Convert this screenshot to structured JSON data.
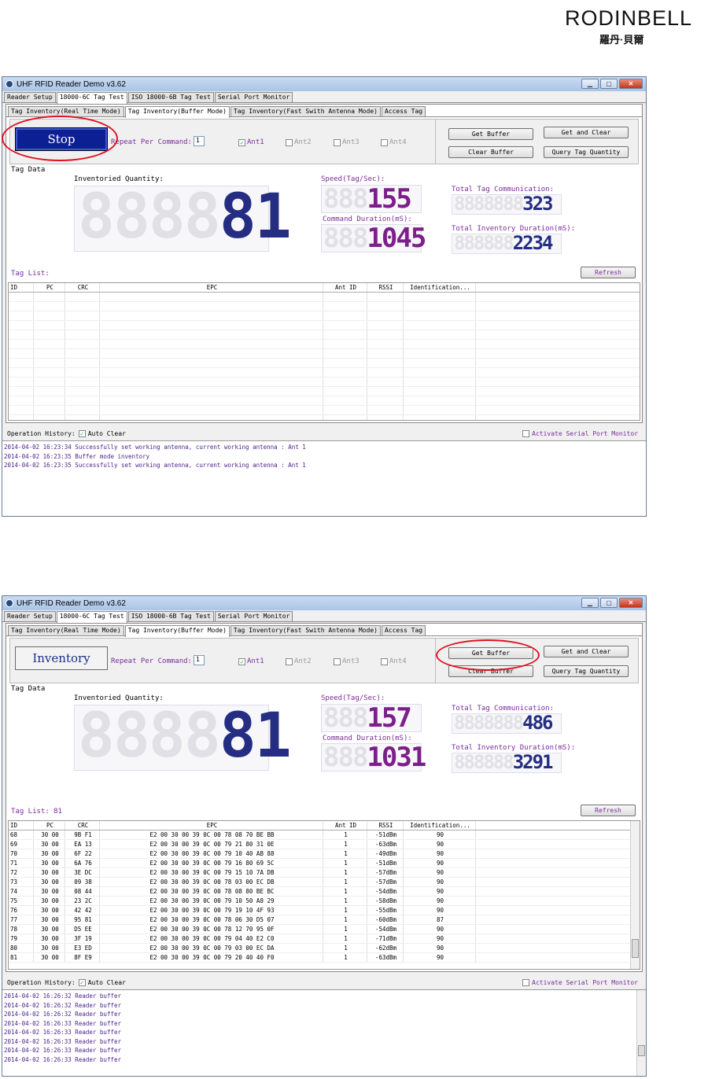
{
  "logo": {
    "brand": "RODINBELL",
    "chinese": "羅丹·貝爾"
  },
  "app": {
    "title": "UHF RFID Reader Demo v3.62"
  },
  "main_tabs": [
    "Reader Setup",
    "18000-6C Tag Test",
    "ISO 18000-6B Tag Test",
    "Serial Port Monitor"
  ],
  "sub_tabs": [
    "Tag Inventory(Real Time Mode)",
    "Tag Inventory(Buffer Mode)",
    "Tag Inventory(Fast Swith Antenna Mode)",
    "Access Tag"
  ],
  "labels": {
    "repeat_per_command": "Repeat Per Command:",
    "tag_data": "Tag Data",
    "inventoried_quantity": "Inventoried Quantity:",
    "speed": "Speed(Tag/Sec):",
    "command_duration": "Command Duration(mS):",
    "total_tag_comm": "Total Tag Communication:",
    "total_inv_duration": "Total Inventory Duration(mS):",
    "refresh": "Refresh",
    "operation_history": "Operation History:",
    "auto_clear": "Auto Clear",
    "activate_serial": "Activate Serial Port Monitor",
    "get_buffer": "Get Buffer",
    "get_and_clear": "Get and Clear",
    "clear_buffer": "Clear Buffer",
    "query_tag_quantity": "Query Tag Quantity"
  },
  "antennas": [
    "Ant1",
    "Ant2",
    "Ant3",
    "Ant4"
  ],
  "columns": [
    "ID",
    "PC",
    "CRC",
    "EPC",
    "Ant ID",
    "RSSI",
    "Identification..."
  ],
  "screen1": {
    "button": "Stop",
    "repeat": "1",
    "inventoried_ghost": "8888",
    "inventoried_value": "81",
    "speed_ghost": "888",
    "speed_value": "155",
    "cmd_ghost": "888",
    "cmd_value": "1045",
    "ttc_ghost": "8888888",
    "ttc_value": "323",
    "tid_ghost": "888888",
    "tid_value": "2234",
    "tag_list": "Tag List:",
    "log": [
      "2014-04-02 16:23:34 Successfully set working antenna, current working antenna : Ant 1",
      "2014-04-02 16:23:35 Buffer mode inventory",
      "2014-04-02 16:23:35 Successfully set working antenna, current working antenna : Ant 1"
    ]
  },
  "screen2": {
    "button": "Inventory",
    "repeat": "1",
    "inventoried_ghost": "8888",
    "inventoried_value": "81",
    "speed_ghost": "888",
    "speed_value": "157",
    "cmd_ghost": "888",
    "cmd_value": "1031",
    "ttc_ghost": "8888888",
    "ttc_value": "486",
    "tid_ghost": "888888",
    "tid_value": "3291",
    "tag_list": "Tag List: 81",
    "rows": [
      [
        "68",
        "30 00",
        "9B F1",
        "E2 00 30 00 39 0C 00 78 08 70 BE BB",
        "1",
        "-51dBm",
        "90"
      ],
      [
        "69",
        "30 00",
        "EA 13",
        "E2 00 30 00 39 0C 00 79 21 80 31 0E",
        "1",
        "-63dBm",
        "90"
      ],
      [
        "70",
        "30 00",
        "6F 22",
        "E2 00 30 00 39 0C 00 79 10 40 AB 88",
        "1",
        "-49dBm",
        "90"
      ],
      [
        "71",
        "30 00",
        "6A 76",
        "E2 00 30 00 39 0C 00 79 16 80 69 5C",
        "1",
        "-51dBm",
        "90"
      ],
      [
        "72",
        "30 00",
        "3E DC",
        "E2 00 30 00 39 0C 00 79 15 10 7A DB",
        "1",
        "-57dBm",
        "90"
      ],
      [
        "73",
        "30 00",
        "09 38",
        "E2 00 30 00 39 0C 00 78 03 00 EC DB",
        "1",
        "-57dBm",
        "90"
      ],
      [
        "74",
        "30 00",
        "08 44",
        "E2 00 30 00 39 0C 00 78 08 80 BE BC",
        "1",
        "-54dBm",
        "90"
      ],
      [
        "75",
        "30 00",
        "23 2C",
        "E2 00 30 00 39 0C 00 79 10 50 A8 29",
        "1",
        "-58dBm",
        "90"
      ],
      [
        "76",
        "30 00",
        "42 42",
        "E2 00 30 00 39 0C 00 79 19 10 4F 93",
        "1",
        "-55dBm",
        "90"
      ],
      [
        "77",
        "30 00",
        "95 81",
        "E2 00 30 00 39 0C 00 78 06 30 D5 07",
        "1",
        "-60dBm",
        "87"
      ],
      [
        "78",
        "30 00",
        "D5 EE",
        "E2 00 30 00 39 0C 00 78 12 70 95 0F",
        "1",
        "-54dBm",
        "90"
      ],
      [
        "79",
        "30 00",
        "3F 19",
        "E2 00 30 00 39 0C 00 79 04 40 E2 C0",
        "1",
        "-71dBm",
        "90"
      ],
      [
        "80",
        "30 00",
        "E3 ED",
        "E2 00 30 00 39 0C 00 79 03 00 EC DA",
        "1",
        "-62dBm",
        "90"
      ],
      [
        "81",
        "30 00",
        "8F E9",
        "E2 00 30 00 39 0C 00 79 20 40 40 F0",
        "1",
        "-63dBm",
        "90"
      ]
    ],
    "log": [
      "2014-04-02 16:26:32 Reader buffer",
      "2014-04-02 16:26:32 Reader buffer",
      "2014-04-02 16:26:32 Reader buffer",
      "2014-04-02 16:26:33 Reader buffer",
      "2014-04-02 16:26:33 Reader buffer",
      "2014-04-02 16:26:33 Reader buffer",
      "2014-04-02 16:26:33 Reader buffer",
      "2014-04-02 16:26:33 Reader buffer"
    ]
  }
}
